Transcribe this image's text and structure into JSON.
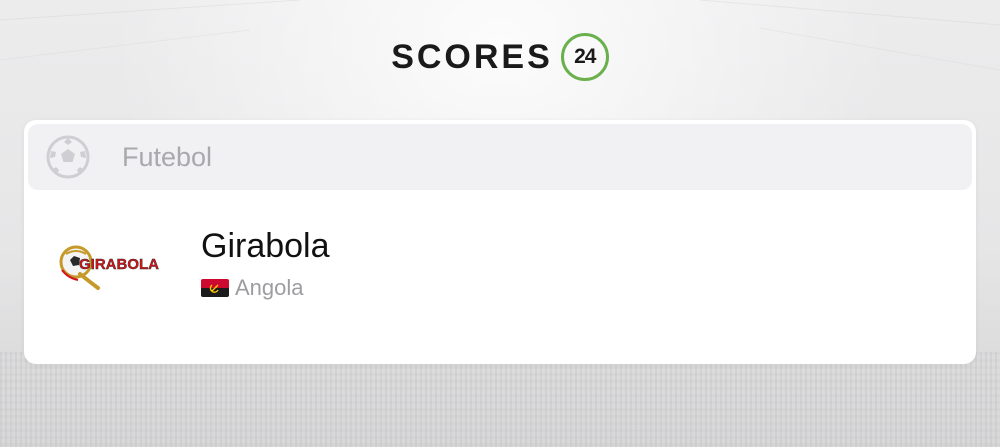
{
  "brand": {
    "wordmark": "SCORES",
    "badge": "24",
    "badge_color": "#6ab04c"
  },
  "sport": {
    "label": "Futebol",
    "icon": "soccer-ball-icon"
  },
  "league": {
    "name": "Girabola",
    "logo_text": "GIRABOLA",
    "logo_color": "#d4141a",
    "country": "Angola",
    "flag_icon": "angola-flag-icon"
  },
  "colors": {
    "accent_green": "#6ab04c",
    "text_primary": "#111111",
    "text_muted": "#9d9da1",
    "header_bg": "#f1f1f3"
  }
}
